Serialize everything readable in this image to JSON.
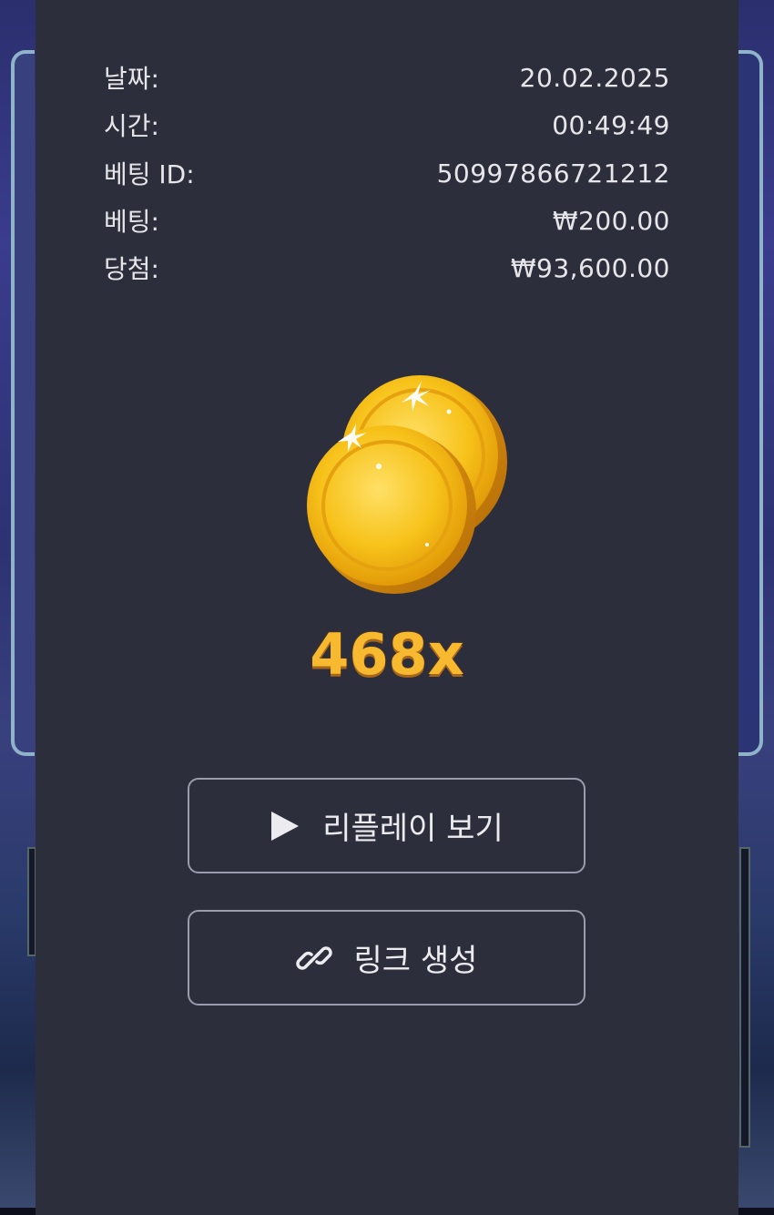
{
  "details": {
    "date_label": "날짜:",
    "date_value": "20.02.2025",
    "time_label": "시간:",
    "time_value": "00:49:49",
    "bet_id_label": "베팅 ID:",
    "bet_id_value": "50997866721212",
    "bet_label": "베팅:",
    "bet_value": "₩200.00",
    "win_label": "당첨:",
    "win_value": "₩93,600.00"
  },
  "result": {
    "multiplier": "468x",
    "icon": "coins-icon"
  },
  "actions": {
    "replay_label": "리플레이 보기",
    "replay_icon": "play-icon",
    "link_label": "링크 생성",
    "link_icon": "link-icon"
  },
  "colors": {
    "panel": "#2d2e3b",
    "text": "#e6e6ea",
    "multiplier": "#f6b92f",
    "button_border": "#9a9bab"
  }
}
